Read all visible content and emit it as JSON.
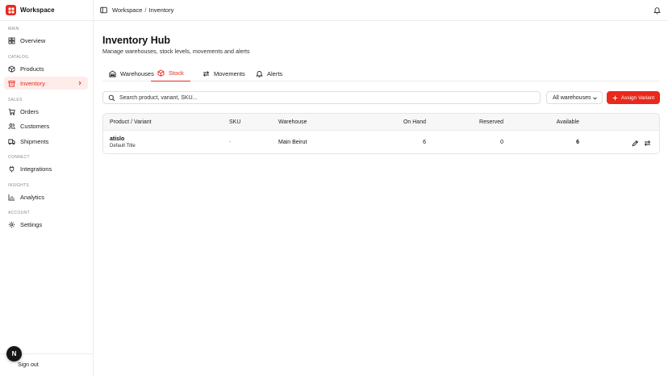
{
  "brand": {
    "name": "Workspace",
    "accent": "#e8291c"
  },
  "sidebar": {
    "sections": [
      {
        "label": "MAIN"
      },
      {
        "label": "CATALOG"
      },
      {
        "label": "SALES"
      },
      {
        "label": "CONNECT"
      },
      {
        "label": "INSIGHTS"
      },
      {
        "label": "ACCOUNT"
      }
    ],
    "items": [
      {
        "label": "Overview",
        "icon": "grid-icon"
      },
      {
        "label": "Products",
        "icon": "box-icon"
      },
      {
        "label": "Inventory",
        "icon": "warehouse-icon",
        "active": true
      },
      {
        "label": "Orders",
        "icon": "cart-icon"
      },
      {
        "label": "Customers",
        "icon": "users-icon"
      },
      {
        "label": "Shipments",
        "icon": "truck-icon"
      },
      {
        "label": "Integrations",
        "icon": "plug-icon"
      },
      {
        "label": "Analytics",
        "icon": "chart-icon"
      },
      {
        "label": "Settings",
        "icon": "gear-icon"
      }
    ],
    "footer": {
      "signout_label": "Sign out",
      "avatar_letter": "N"
    }
  },
  "topbar": {
    "breadcrumb": {
      "root": "Workspace",
      "separator": "/",
      "current": "Inventory"
    }
  },
  "page": {
    "title": "Inventory Hub",
    "subtitle": "Manage warehouses, stock levels, movements and alerts"
  },
  "tabs": [
    {
      "label": "Warehouses",
      "icon": "warehouse-icon"
    },
    {
      "label": "Stock",
      "icon": "package-icon",
      "active": true
    },
    {
      "label": "Movements",
      "icon": "arrows-icon"
    },
    {
      "label": "Alerts",
      "icon": "bell-icon"
    }
  ],
  "toolbar": {
    "search_placeholder": "Search product, variant, SKU...",
    "warehouse_filter": "All warehouses",
    "assign_label": "Assign Variant"
  },
  "table": {
    "columns": [
      "Product / Variant",
      "SKU",
      "Warehouse",
      "On Hand",
      "Reserved",
      "Available"
    ],
    "rows": [
      {
        "product": "atislo",
        "variant": "Default Title",
        "sku": "-",
        "warehouse": "Main Beirut",
        "on_hand": "6",
        "reserved": "0",
        "available": "6"
      }
    ]
  }
}
